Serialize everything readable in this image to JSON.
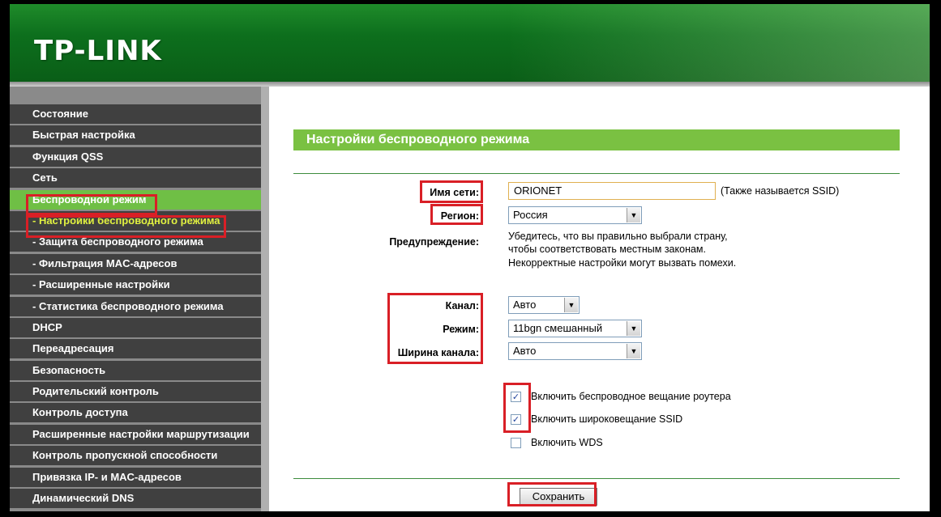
{
  "brand": "TP-LINK",
  "sidebar": {
    "items": [
      {
        "label": "Состояние"
      },
      {
        "label": "Быстрая настройка"
      },
      {
        "label": "Функция QSS"
      },
      {
        "label": "Сеть"
      },
      {
        "label": "Беспроводной режим"
      },
      {
        "label": "- Настройки беспроводного режима"
      },
      {
        "label": "- Защита беспроводного режима"
      },
      {
        "label": "- Фильтрация MAC-адресов"
      },
      {
        "label": "- Расширенные настройки"
      },
      {
        "label": "- Статистика беспроводного режима"
      },
      {
        "label": "DHCP"
      },
      {
        "label": "Переадресация"
      },
      {
        "label": "Безопасность"
      },
      {
        "label": "Родительский контроль"
      },
      {
        "label": "Контроль доступа"
      },
      {
        "label": "Расширенные настройки маршрутизации"
      },
      {
        "label": "Контроль пропускной способности"
      },
      {
        "label": "Привязка IP- и MAC-адресов"
      },
      {
        "label": "Динамический DNS"
      }
    ]
  },
  "main": {
    "title": "Настройки беспроводного режима",
    "ssid": {
      "label": "Имя сети:",
      "value": "ORIONET",
      "hint": "(Также называется SSID)"
    },
    "region": {
      "label": "Регион:",
      "value": "Россия"
    },
    "warning": {
      "label": "Предупреждение:",
      "lines": [
        "Убедитесь, что вы правильно выбрали страну,",
        "чтобы соответствовать местным законам.",
        "Некорректные настройки могут вызвать помехи."
      ]
    },
    "channel": {
      "label": "Канал:",
      "value": "Авто"
    },
    "mode": {
      "label": "Режим:",
      "value": "11bgn смешанный"
    },
    "width": {
      "label": "Ширина канала:",
      "value": "Авто"
    },
    "checkboxes": [
      {
        "label": "Включить беспроводное вещание роутера",
        "checked": true
      },
      {
        "label": "Включить широковещание SSID",
        "checked": true
      },
      {
        "label": "Включить WDS",
        "checked": false
      }
    ],
    "save_label": "Сохранить"
  },
  "colors": {
    "header_green": "#0d6f1d",
    "menu_active": "#6fbf45",
    "menu_item": "#404040",
    "section_bar": "#7ac142",
    "highlight_red": "#d91f26"
  }
}
